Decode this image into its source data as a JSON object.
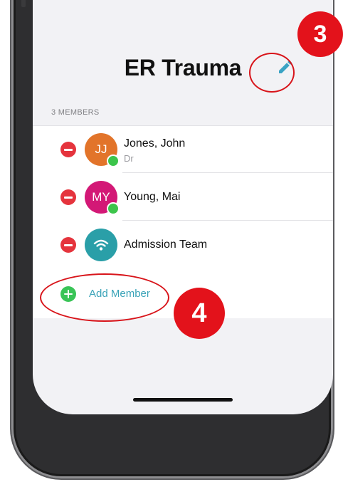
{
  "group": {
    "title": "ER Trauma",
    "members_header": "3 MEMBERS"
  },
  "members": [
    {
      "initials": "JJ",
      "name": "Jones, John",
      "subtitle": "Dr",
      "avatar_color": "#e2742a",
      "online": true
    },
    {
      "initials": "MY",
      "name": "Young, Mai",
      "subtitle": "",
      "avatar_color": "#d31876",
      "online": true
    },
    {
      "initials": "",
      "name": "Admission Team",
      "subtitle": "",
      "avatar_color": "#2a9fa8",
      "online": false,
      "icon": "wifi-icon"
    }
  ],
  "actions": {
    "add_member_label": "Add Member",
    "edit_icon": "pencil-icon"
  },
  "annotations": {
    "badge_edit": "3",
    "badge_add": "4"
  },
  "colors": {
    "remove": "#e5343d",
    "add": "#39c457",
    "link": "#3aa3b8",
    "annotation": "#e3121b"
  }
}
